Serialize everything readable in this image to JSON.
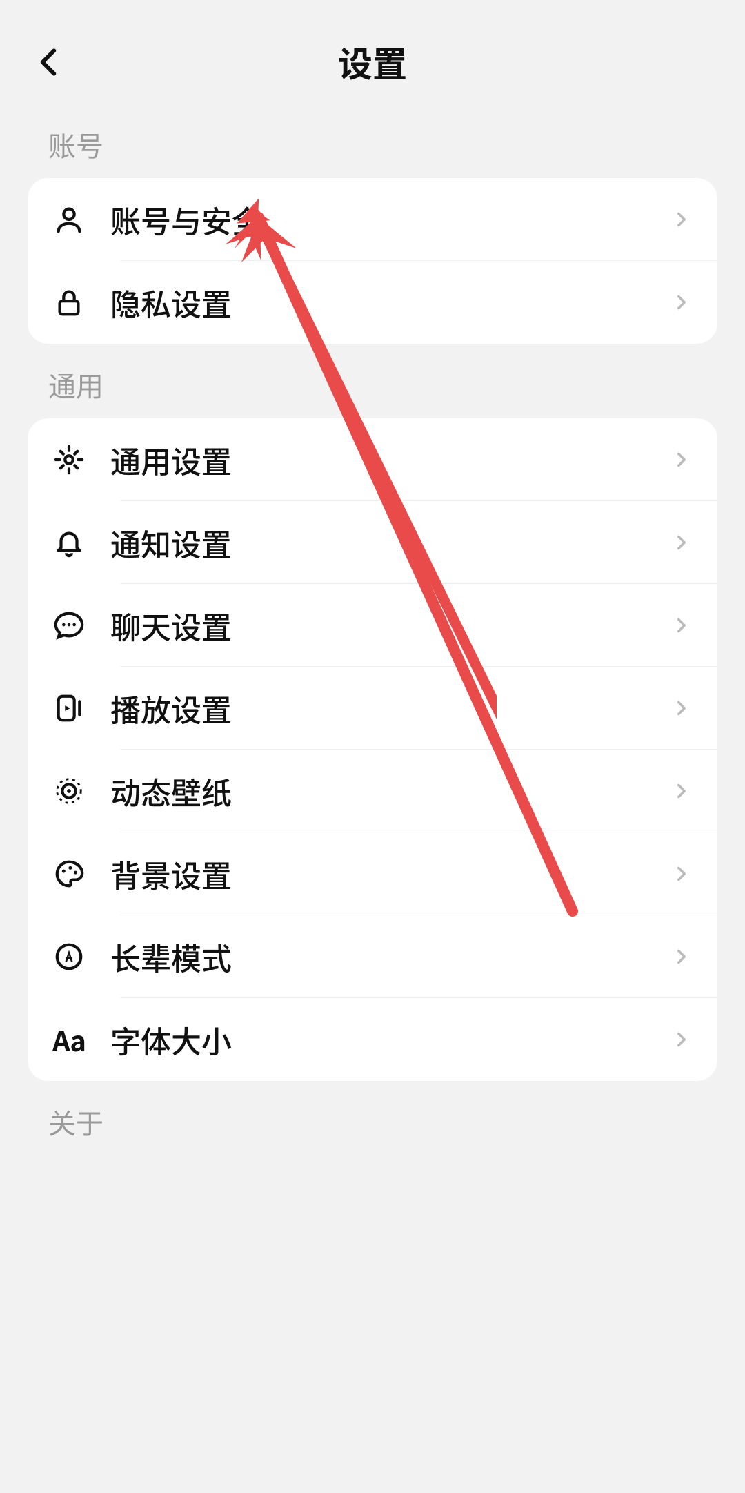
{
  "header": {
    "title": "设置"
  },
  "sections": {
    "account": {
      "header": "账号",
      "items": [
        {
          "icon": "user-icon",
          "label": "账号与安全"
        },
        {
          "icon": "lock-icon",
          "label": "隐私设置"
        }
      ]
    },
    "general": {
      "header": "通用",
      "items": [
        {
          "icon": "gear-icon",
          "label": "通用设置"
        },
        {
          "icon": "bell-icon",
          "label": "通知设置"
        },
        {
          "icon": "chat-icon",
          "label": "聊天设置"
        },
        {
          "icon": "play-icon",
          "label": "播放设置"
        },
        {
          "icon": "wallpaper-icon",
          "label": "动态壁纸"
        },
        {
          "icon": "palette-icon",
          "label": "背景设置"
        },
        {
          "icon": "accessibility-icon",
          "label": "长辈模式"
        },
        {
          "icon": "font-icon",
          "label": "字体大小"
        }
      ]
    },
    "about": {
      "header": "关于"
    }
  },
  "annotation": {
    "type": "arrow",
    "color": "#e94a4a"
  }
}
